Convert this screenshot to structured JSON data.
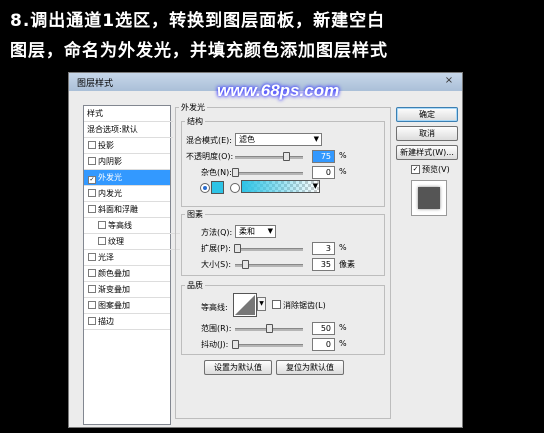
{
  "caption": {
    "line1": "8.调出通道1选区，转换到图层面板，新建空白",
    "line2": "图层，命名为外发光，并填充颜色添加图层样式"
  },
  "watermark": "www.68ps.com",
  "dialog": {
    "title": "图层样式",
    "close": "×",
    "left_list": {
      "header": "样式",
      "blend_default": "混合选项:默认",
      "items": [
        {
          "label": "投影",
          "checked": false
        },
        {
          "label": "内阴影",
          "checked": false
        },
        {
          "label": "外发光",
          "checked": true,
          "selected": true
        },
        {
          "label": "内发光",
          "checked": false
        },
        {
          "label": "斜面和浮雕",
          "checked": false
        },
        {
          "label": "等高线",
          "checked": false,
          "sub": true
        },
        {
          "label": "纹理",
          "checked": false,
          "sub": true
        },
        {
          "label": "光泽",
          "checked": false
        },
        {
          "label": "颜色叠加",
          "checked": false
        },
        {
          "label": "渐变叠加",
          "checked": false
        },
        {
          "label": "图案叠加",
          "checked": false
        },
        {
          "label": "描边",
          "checked": false
        }
      ],
      "checkmark": "✓"
    },
    "panel_title": "外发光",
    "structure": {
      "title": "结构",
      "blend_mode_label": "混合模式(E):",
      "blend_mode_value": "滤色",
      "opacity_label": "不透明度(O):",
      "opacity_value": "75",
      "opacity_unit": "%",
      "opacity_fraction": 0.75,
      "noise_label": "杂色(N):",
      "noise_value": "0",
      "noise_unit": "%",
      "noise_fraction": 0.0,
      "glow_color": "#2ec4e6"
    },
    "elements": {
      "title": "图素",
      "method_label": "方法(Q):",
      "method_value": "柔和",
      "spread_label": "扩展(P):",
      "spread_value": "3",
      "spread_unit": "%",
      "spread_fraction": 0.03,
      "size_label": "大小(S):",
      "size_value": "35",
      "size_unit": "像素",
      "size_fraction": 0.14
    },
    "quality": {
      "title": "品质",
      "contour_label": "等高线:",
      "antialias_label": "消除锯齿(L)",
      "range_label": "范围(R):",
      "range_value": "50",
      "range_unit": "%",
      "range_fraction": 0.5,
      "jitter_label": "抖动(J):",
      "jitter_value": "0",
      "jitter_unit": "%",
      "jitter_fraction": 0.0
    },
    "buttons": {
      "ok": "确定",
      "cancel": "取消",
      "new_style": "新建样式(W)...",
      "preview": "预览(V)",
      "make_default": "设置为默认值",
      "reset_default": "复位为默认值"
    }
  }
}
